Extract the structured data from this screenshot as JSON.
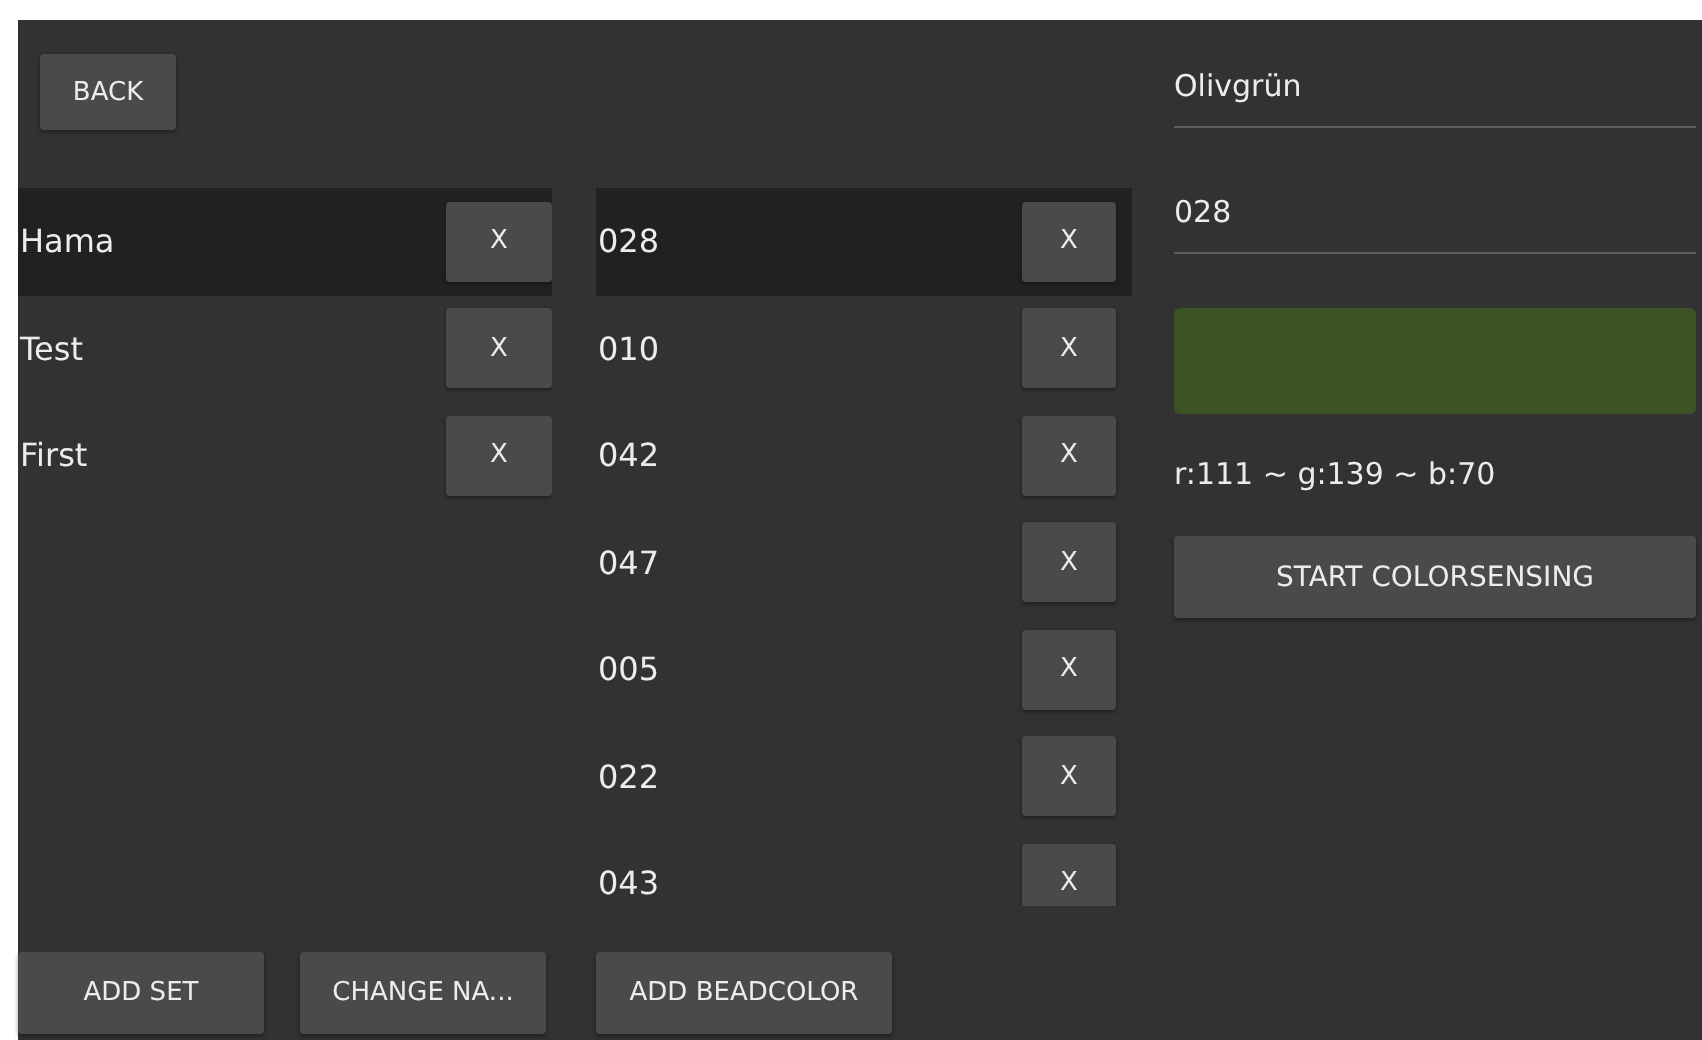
{
  "back_button": "BACK",
  "sets": [
    {
      "name": "Hama",
      "delete": "X",
      "selected": true
    },
    {
      "name": "Test",
      "delete": "X",
      "selected": false
    },
    {
      "name": "First",
      "delete": "X",
      "selected": false
    }
  ],
  "beadcolors": [
    {
      "name": "028",
      "delete": "X",
      "selected": true
    },
    {
      "name": "010",
      "delete": "X",
      "selected": false
    },
    {
      "name": "042",
      "delete": "X",
      "selected": false
    },
    {
      "name": "047",
      "delete": "X",
      "selected": false
    },
    {
      "name": "005",
      "delete": "X",
      "selected": false
    },
    {
      "name": "022",
      "delete": "X",
      "selected": false
    },
    {
      "name": "043",
      "delete": "X",
      "selected": false
    }
  ],
  "detail": {
    "fields": [
      {
        "value": "Olivgrün"
      },
      {
        "value": "028"
      }
    ],
    "swatch": {
      "color": "#3c5323"
    },
    "rgb": "r:111 ~ g:139 ~ b:70",
    "sense_button": "START COLORSENSING"
  },
  "set_buttons": [
    "ADD SET",
    "CHANGE NA..."
  ],
  "beadcolor_buttons": [
    "ADD BEADCOLOR"
  ]
}
